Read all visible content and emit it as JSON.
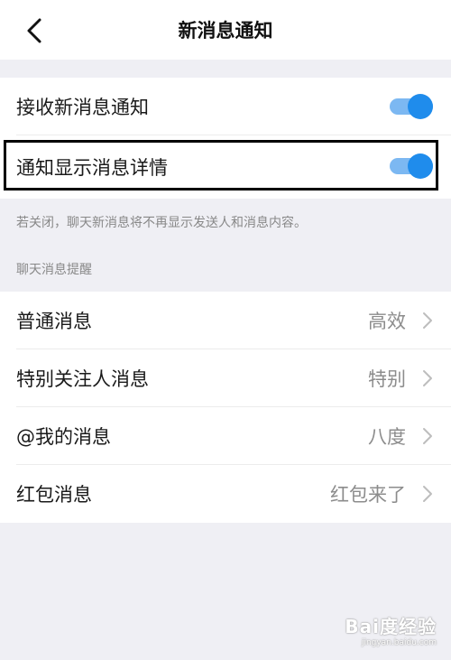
{
  "nav": {
    "title": "新消息通知"
  },
  "switches": [
    {
      "label": "接收新消息通知",
      "on": true
    },
    {
      "label": "通知显示消息详情",
      "on": true
    }
  ],
  "hint": "若关闭，聊天新消息将不再显示发送人和消息内容。",
  "section_title": "聊天消息提醒",
  "items": [
    {
      "label": "普通消息",
      "value": "高效"
    },
    {
      "label": "特别关注人消息",
      "value": "特别"
    },
    {
      "label": "@我的消息",
      "value": "八度"
    },
    {
      "label": "红包消息",
      "value": "红包来了"
    }
  ],
  "watermark": {
    "brand": "Bai度经验",
    "url": "jingyan.baidu.com"
  },
  "colors": {
    "accent": "#1f8cec",
    "track": "#7cb8f2",
    "background": "#efeff4"
  }
}
